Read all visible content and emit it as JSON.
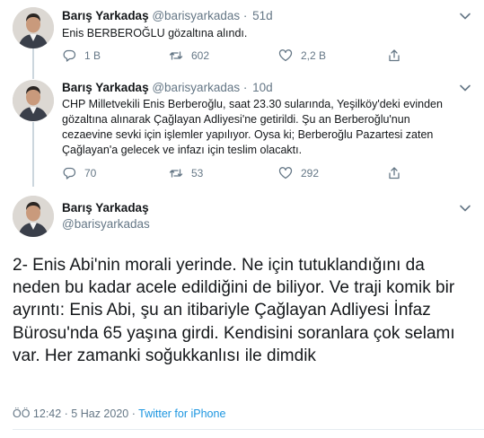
{
  "colors": {
    "accent": "#1b95e0",
    "text": "#14171a",
    "muted": "#657786",
    "divider": "#e6ecf0"
  },
  "tweets": [
    {
      "name": "Barış Yarkadaş",
      "handle": "@barisyarkadas",
      "separator": "·",
      "time": "51d",
      "text": "Enis BERBEROĞLU gözaltına alındı.",
      "reply_count": "1 B",
      "retweet_count": "602",
      "like_count": "2,2 B"
    },
    {
      "name": "Barış Yarkadaş",
      "handle": "@barisyarkadas",
      "separator": "·",
      "time": "10d",
      "text_lines": [
        "CHP Milletvekili Enis Berberoğlu, saat 23.30 sularında, Yeşilköy'deki evinden",
        "gözaltına alınarak Çağlayan Adliyesi'ne getirildi. Şu an Berberoğlu'nun",
        "cezaevine sevki için işlemler yapılıyor. Oysa ki; Berberoğlu Pazartesi zaten",
        "Çağlayan'a gelecek ve infazı için teslim olacaktı."
      ],
      "reply_count": "70",
      "retweet_count": "53",
      "like_count": "292"
    }
  ],
  "main_tweet": {
    "name": "Barış Yarkadaş",
    "handle": "@barisyarkadas",
    "text": "2- Enis Abi'nin morali yerinde. Ne için tutuklandığını da neden bu kadar acele edildiğini de biliyor. Ve traji komik bir ayrıntı: Enis Abi, şu an itibariyle Çağlayan Adliyesi İnfaz Bürosu'nda 65 yaşına girdi. Kendisini soranlara çok selamı var. Her zamanki soğukkanlısı ile dimdik",
    "meta_time": "ÖÖ 12:42 · 5 Haz 2020 ·",
    "meta_source": "Twitter for iPhone"
  },
  "icons": [
    "reply-icon",
    "retweet-icon",
    "like-icon",
    "share-icon",
    "chevron-down-icon",
    "avatar"
  ]
}
